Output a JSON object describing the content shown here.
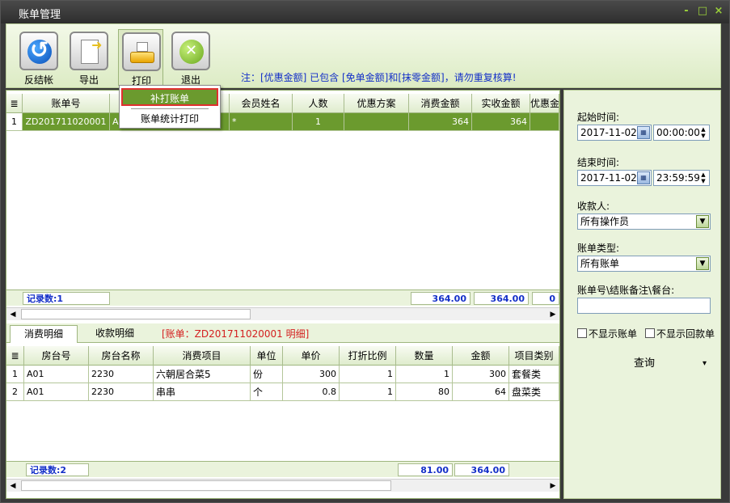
{
  "window": {
    "title": "账单管理",
    "minimize": "-",
    "maximize": "□",
    "close": "×"
  },
  "toolbar": {
    "buttons": [
      {
        "label": "反结帐",
        "icon": "undo-icon"
      },
      {
        "label": "导出",
        "icon": "export-icon"
      },
      {
        "label": "打印",
        "icon": "print-icon"
      },
      {
        "label": "退出",
        "icon": "exit-icon"
      }
    ],
    "note": "注：[优惠金额] 已包含 [免单金额]和[抹零金额]，请勿重复核算!"
  },
  "print_menu": {
    "items": [
      "补打账单",
      "账单统计打印"
    ]
  },
  "bill_grid": {
    "corner": "≣",
    "columns": [
      "账单号",
      "会员姓名",
      "人数",
      "优惠方案",
      "消费金额",
      "实收金额",
      "优惠金"
    ],
    "rows": [
      {
        "idx": "1",
        "bill_no": "ZD201711020001",
        "col2": "A0",
        "member": "*",
        "people": "1",
        "plan": "",
        "amount": "364",
        "received": "364",
        "discount": ""
      }
    ],
    "footer": {
      "count_label": "记录数:1",
      "amount": "364.00",
      "received": "364.00",
      "discount": "0"
    }
  },
  "tabs": {
    "items": [
      "消费明细",
      "收款明细"
    ],
    "bill_label": "[账单：ZD201711020001 明细]"
  },
  "detail_grid": {
    "corner": "≣",
    "columns": [
      "房台号",
      "房台名称",
      "消费项目",
      "单位",
      "单价",
      "打折比例",
      "数量",
      "金额",
      "项目类别"
    ],
    "rows": [
      {
        "idx": "1",
        "room": "A01",
        "room_name": "2230",
        "item": "六朝居合菜5",
        "unit": "份",
        "price": "300",
        "discount": "1",
        "qty": "1",
        "amount": "300",
        "category": "套餐类"
      },
      {
        "idx": "2",
        "room": "A01",
        "room_name": "2230",
        "item": "串串",
        "unit": "个",
        "price": "0.8",
        "discount": "1",
        "qty": "80",
        "amount": "64",
        "category": "盘菜类"
      }
    ],
    "footer": {
      "count_label": "记录数:2",
      "qty": "81.00",
      "amount": "364.00"
    }
  },
  "filters": {
    "start_label": "起始时间:",
    "start_date": "2017-11-02",
    "start_time": "00:00:00",
    "end_label": "结束时间:",
    "end_date": "2017-11-02",
    "end_time": "23:59:59",
    "cashier_label": "收款人:",
    "cashier_value": "所有操作员",
    "type_label": "账单类型:",
    "type_value": "所有账单",
    "search_label": "账单号\\结账备注\\餐台:",
    "search_value": "",
    "hide_bills": "不显示账单",
    "hide_refunds": "不显示回款单",
    "query": "查询",
    "query_arrow": "▾"
  }
}
